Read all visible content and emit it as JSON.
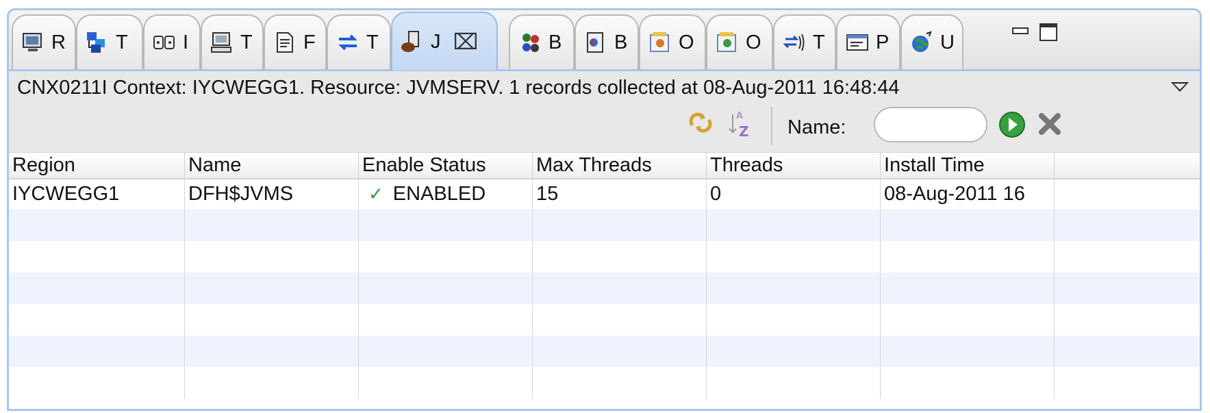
{
  "tabs": [
    {
      "label": "R",
      "icon": "region-monitor-icon"
    },
    {
      "label": "T",
      "icon": "transaction-icon"
    },
    {
      "label": "I",
      "icon": "ipconn-icon"
    },
    {
      "label": "T",
      "icon": "terminal-icon"
    },
    {
      "label": "F",
      "icon": "file-icon"
    },
    {
      "label": "T",
      "icon": "tcpip-service-icon"
    },
    {
      "label": "J",
      "icon": "jvmserver-icon",
      "active": true
    },
    {
      "label": "B",
      "icon": "bundle-icon"
    },
    {
      "label": "B",
      "icon": "bundle-part-icon"
    },
    {
      "label": "O",
      "icon": "osgi-bundle-icon"
    },
    {
      "label": "O",
      "icon": "osgi-service-icon"
    },
    {
      "label": "T",
      "icon": "tsqueue-icon"
    },
    {
      "label": "P",
      "icon": "program-icon"
    },
    {
      "label": "U",
      "icon": "uri-map-icon"
    }
  ],
  "window_controls": {
    "minimize": "minimize-icon",
    "maximize": "maximize-icon"
  },
  "context_message": "CNX0211I Context: IYCWEGG1. Resource: JVMSERV. 1 records collected at 08-Aug-2011 16:48:44",
  "toolbar": {
    "refresh_icon": "refresh-icon",
    "sort_icon": "sort-az-icon",
    "name_label": "Name:",
    "name_value": "",
    "apply_icon": "run-filter-icon",
    "clear_icon": "clear-filter-icon"
  },
  "table": {
    "columns": [
      "Region",
      "Name",
      "Enable Status",
      "Max Threads",
      "Threads",
      "Install Time"
    ],
    "rows": [
      {
        "region": "IYCWEGG1",
        "name": "DFH$JVMS",
        "enable_status": "ENABLED",
        "max_threads": "15",
        "threads": "0",
        "install_time": "08-Aug-2011 16"
      }
    ]
  },
  "colors": {
    "accent": "#a6c8ee",
    "alt_row": "#eef3fd",
    "ok_green": "#3a9a3a"
  }
}
